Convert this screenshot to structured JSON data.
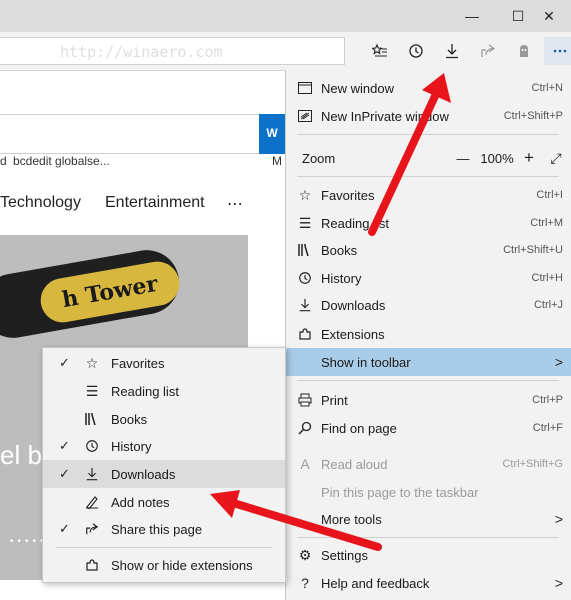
{
  "window": {
    "minimize": "—",
    "maximize": "☐",
    "close": "✕"
  },
  "toolbar": {
    "address_text": "http://winaero.com",
    "icons": [
      "favorites-bar-icon",
      "history-icon",
      "downloads-icon",
      "share-icon",
      "extension-icon",
      "more-icon"
    ]
  },
  "page": {
    "search_button": "W",
    "suggestions": [
      "d",
      "bcdedit globalse...",
      "M"
    ],
    "nav": [
      "Technology",
      "Entertainment",
      "⋯"
    ],
    "sign_text": "h Tower",
    "hero_text": "el b",
    "dots": "•••••"
  },
  "menu": {
    "items": [
      {
        "label": "New window",
        "shortcut": "Ctrl+N",
        "icon": "new-window-icon"
      },
      {
        "label": "New InPrivate window",
        "shortcut": "Ctrl+Shift+P",
        "icon": "inprivate-icon"
      },
      {
        "label": "Zoom",
        "zoom_value": "100%",
        "zoom_minus": "—",
        "zoom_plus": "+",
        "fullscreen": "⤢"
      },
      {
        "label": "Favorites",
        "shortcut": "Ctrl+I",
        "icon": "star-list-icon"
      },
      {
        "label": "Reading list",
        "shortcut": "Ctrl+M",
        "icon": "reading-list-icon"
      },
      {
        "label": "Books",
        "shortcut": "Ctrl+Shift+U",
        "icon": "books-icon"
      },
      {
        "label": "History",
        "shortcut": "Ctrl+H",
        "icon": "history-icon"
      },
      {
        "label": "Downloads",
        "shortcut": "Ctrl+J",
        "icon": "downloads-icon"
      },
      {
        "label": "Extensions",
        "shortcut": "",
        "icon": "extensions-icon"
      },
      {
        "label": "Show in toolbar",
        "shortcut": "",
        "icon": "",
        "chevron": ">"
      },
      {
        "label": "Print",
        "shortcut": "Ctrl+P",
        "icon": "print-icon"
      },
      {
        "label": "Find on page",
        "shortcut": "Ctrl+F",
        "icon": "find-icon"
      },
      {
        "label": "Read aloud",
        "shortcut": "Ctrl+Shift+G",
        "icon": "read-aloud-icon"
      },
      {
        "label": "Pin this page to the taskbar",
        "shortcut": "",
        "icon": ""
      },
      {
        "label": "More tools",
        "shortcut": "",
        "icon": "",
        "chevron": ">"
      },
      {
        "label": "Settings",
        "shortcut": "",
        "icon": "settings-icon"
      },
      {
        "label": "Help and feedback",
        "shortcut": "",
        "icon": "help-icon",
        "chevron": ">"
      }
    ]
  },
  "submenu": {
    "items": [
      {
        "label": "Favorites",
        "checked": true,
        "icon": "star-list-icon"
      },
      {
        "label": "Reading list",
        "checked": false,
        "icon": "reading-list-icon"
      },
      {
        "label": "Books",
        "checked": false,
        "icon": "books-icon"
      },
      {
        "label": "History",
        "checked": true,
        "icon": "history-icon"
      },
      {
        "label": "Downloads",
        "checked": true,
        "icon": "downloads-icon"
      },
      {
        "label": "Add notes",
        "checked": false,
        "icon": "pen-icon"
      },
      {
        "label": "Share this page",
        "checked": true,
        "icon": "share-icon"
      },
      {
        "label": "Show or hide extensions",
        "checked": false,
        "icon": "extensions-icon"
      }
    ],
    "check_glyph": "✓"
  },
  "colors": {
    "accent": "#0a73c9",
    "highlight": "#a9cce9",
    "arrow": "#e8141c"
  }
}
